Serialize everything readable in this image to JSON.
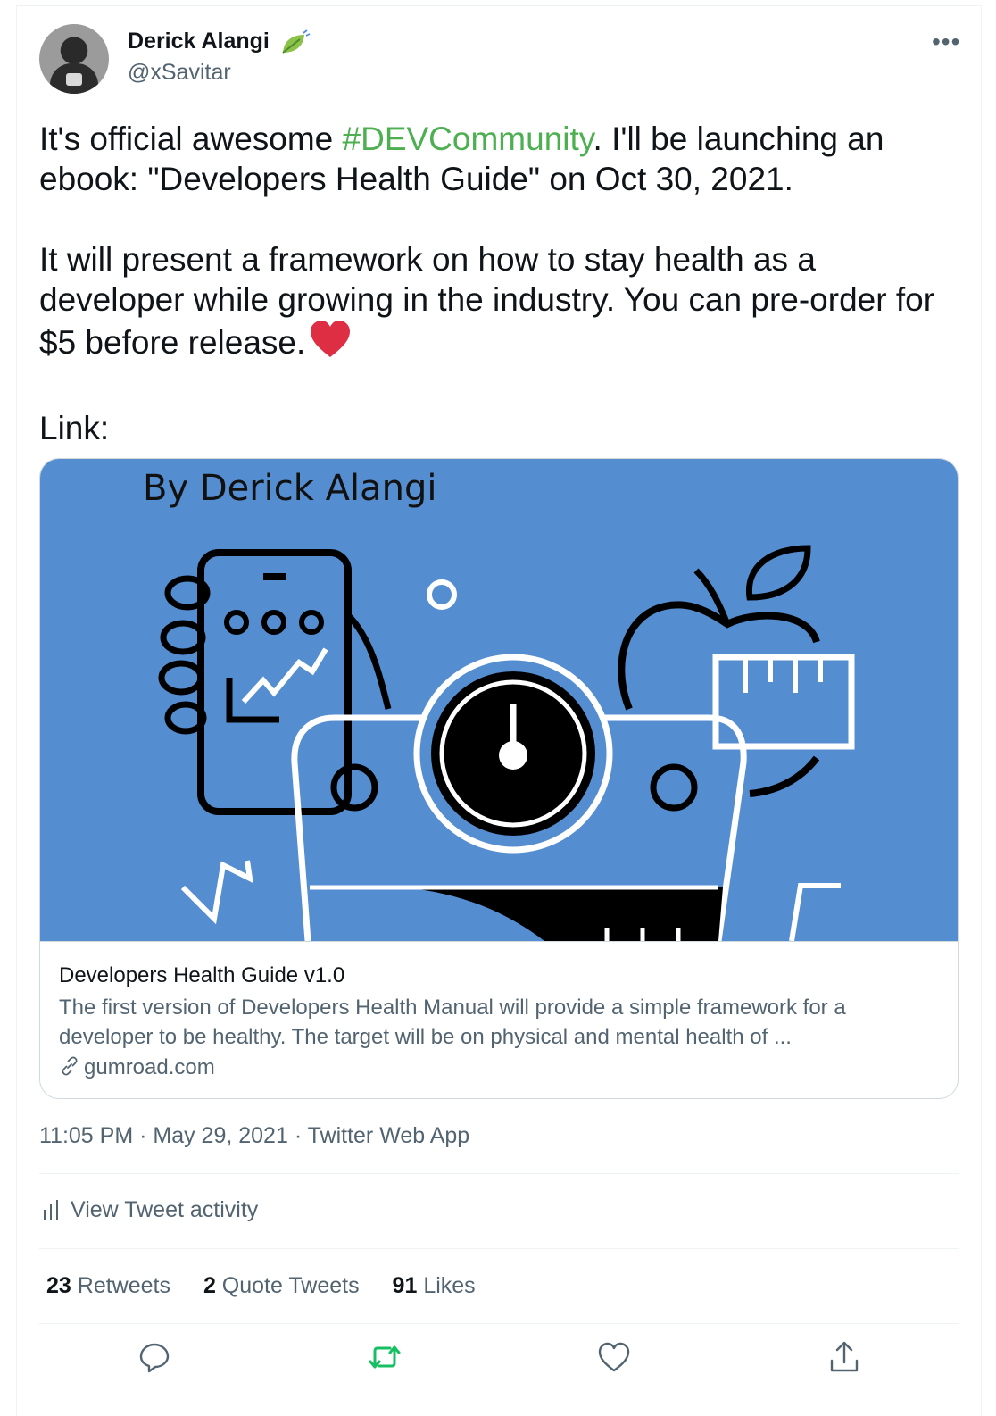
{
  "author": {
    "name": "Derick Alangi",
    "handle": "@xSavitar",
    "badge_icon": "leaf-icon"
  },
  "tweet": {
    "line1_prefix": "It's official awesome ",
    "hashtag": "#DEVCommunity",
    "line1_suffix": ". I'll be launching an ebook: \"Developers Health Guide\" on Oct 30, 2021.",
    "paragraph2": "It will present a framework on how to stay health as a developer while growing in the industry. You can pre-order for $5 before release.",
    "emoji": "red-heart-emoji",
    "paragraph3": "Link:"
  },
  "card": {
    "image_caption": "By Derick Alangi",
    "title": "Developers Health Guide v1.0",
    "description": "The first version of Developers Health Manual will provide a simple framework for a developer to be healthy. The target will be on physical and mental health of ...",
    "domain": "gumroad.com",
    "image_background": "#548ed0"
  },
  "meta": {
    "time": "11:05 PM",
    "separator": " · ",
    "date": "May 29, 2021",
    "source": "Twitter Web App"
  },
  "activity": {
    "label": "View Tweet activity"
  },
  "stats": {
    "retweets_count": "23",
    "retweets_label": "Retweets",
    "quotes_count": "2",
    "quotes_label": "Quote Tweets",
    "likes_count": "91",
    "likes_label": "Likes"
  },
  "colors": {
    "hashtag": "#4caf50",
    "secondary_text": "#536471",
    "retweet_icon": "#17bf63"
  }
}
